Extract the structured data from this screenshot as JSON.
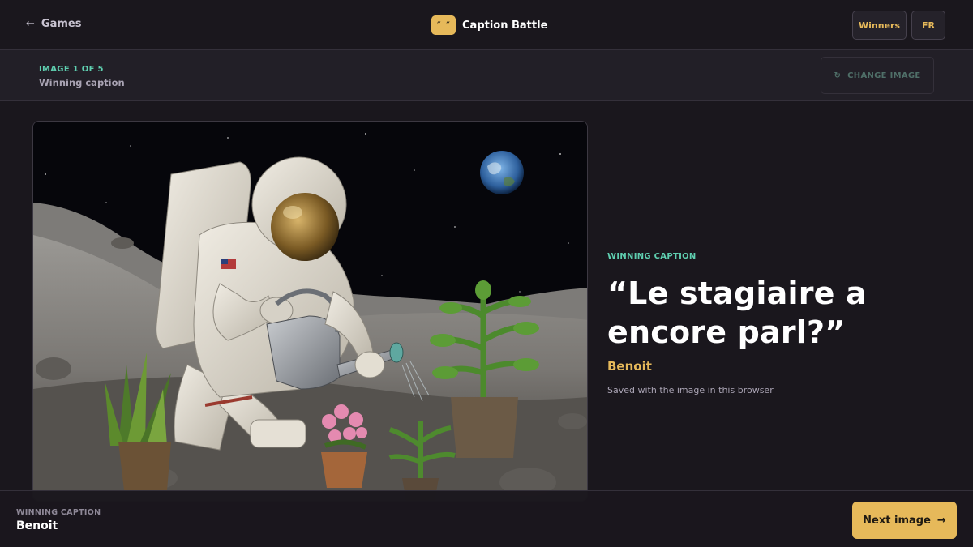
{
  "header": {
    "back_label": "Games",
    "back_icon": "←",
    "logo_glyph": "˝ ˝",
    "title": "Caption Battle",
    "winners_label": "Winners",
    "lang_label": "FR"
  },
  "subbar": {
    "counter": "IMAGE 1 OF 5",
    "subtitle": "Winning caption",
    "change_icon": "↻",
    "change_label": "CHANGE IMAGE"
  },
  "caption": {
    "label": "WINNING CAPTION",
    "text": "“Le stagiaire a encore parl?”",
    "author": "Benoit",
    "note": "Saved with the image in this browser"
  },
  "footer": {
    "label": "WINNING CAPTION",
    "name": "Benoit",
    "next_label": "Next image",
    "next_icon": "→"
  },
  "colors": {
    "accent": "#e6b95a",
    "teal": "#5fcfb0",
    "background": "#1a171d"
  }
}
